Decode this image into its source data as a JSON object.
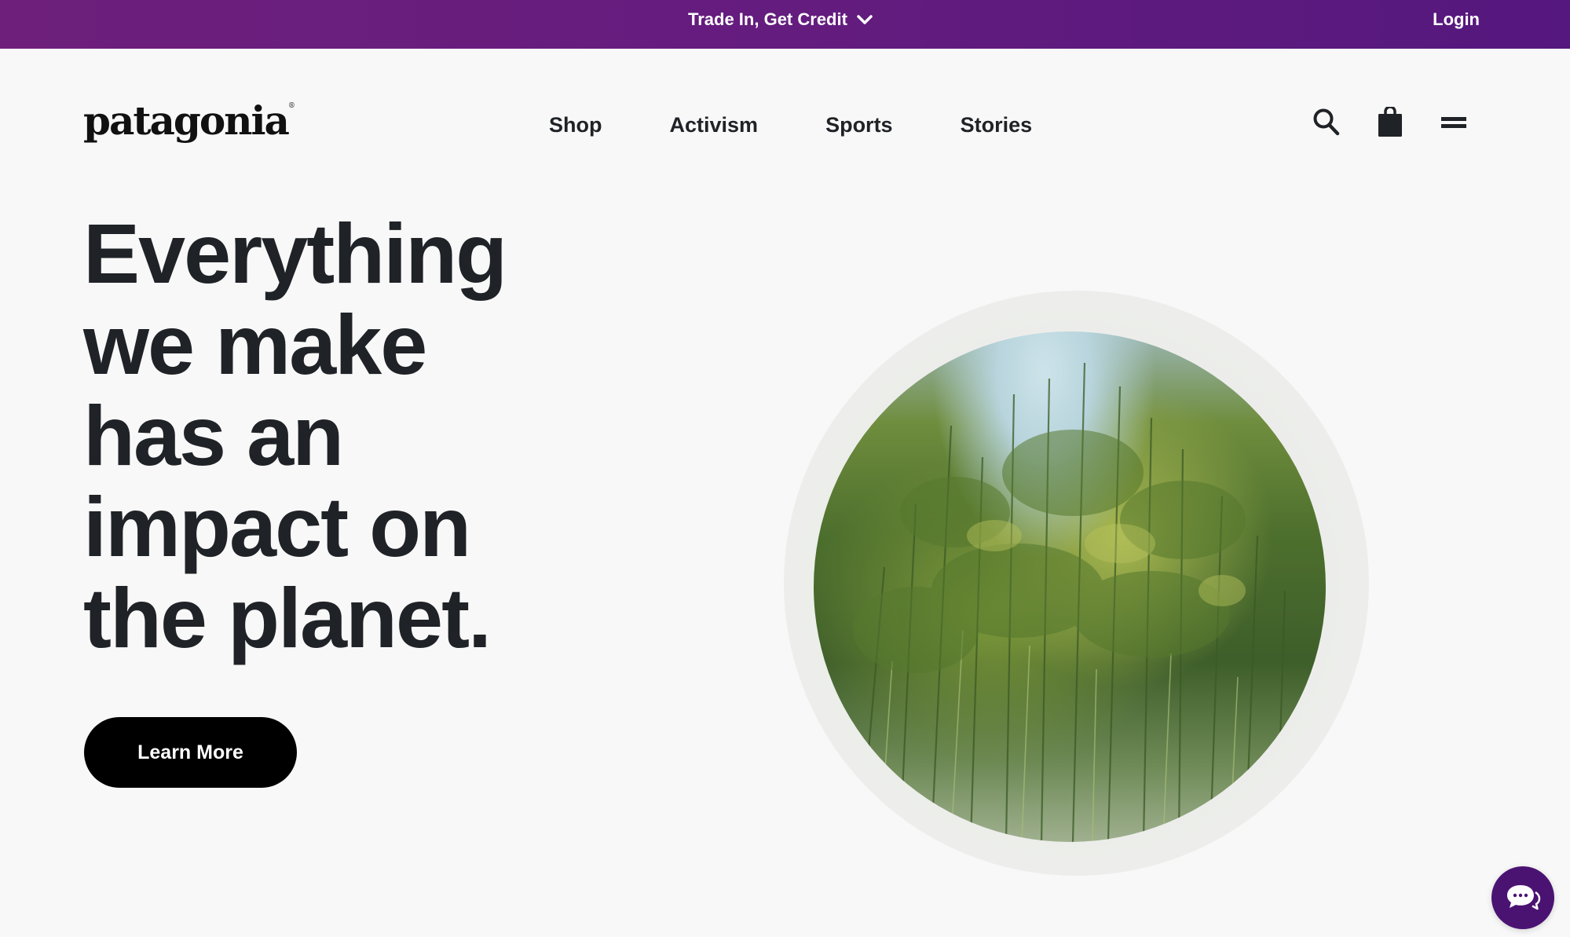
{
  "promo": {
    "label": "Trade In, Get Credit",
    "login": "Login"
  },
  "header": {
    "logo": "patagonia",
    "logo_mark": "®",
    "nav": [
      "Shop",
      "Activism",
      "Sports",
      "Stories"
    ]
  },
  "icons": {
    "promo_chevron": "chevron-down-icon",
    "search": "search-icon",
    "bag": "shopping-bag-icon",
    "menu": "menu-icon",
    "chat": "chat-icon"
  },
  "hero": {
    "headline_lines": [
      "Everything",
      "we make",
      "has an",
      "impact on",
      "the planet."
    ],
    "cta": "Learn More"
  },
  "colors": {
    "promo_bar": "#641c7e",
    "text": "#1f2226",
    "cta_bg": "#000000",
    "chat_bg": "#4a1372",
    "page_bg": "#f8f8f8"
  }
}
